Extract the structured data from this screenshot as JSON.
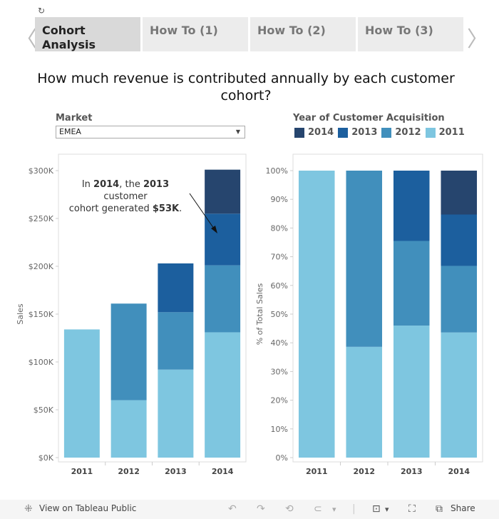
{
  "tabs": {
    "items": [
      {
        "label": "Cohort Analysis",
        "active": true
      },
      {
        "label": "How To (1)",
        "active": false
      },
      {
        "label": "How To (2)",
        "active": false
      },
      {
        "label": "How To (3)",
        "active": false
      }
    ]
  },
  "icons": {
    "refresh": "↻",
    "prev": "〈",
    "next": "〉"
  },
  "title": "How much revenue is contributed annually by each customer cohort?",
  "filter": {
    "label": "Market",
    "value": "EMEA",
    "arrow": "▼"
  },
  "legend": {
    "title": "Year of Customer Acquisition",
    "items": [
      {
        "label": "2014",
        "color": "#26456e"
      },
      {
        "label": "2013",
        "color": "#1c5f9e"
      },
      {
        "label": "2012",
        "color": "#418fbc"
      },
      {
        "label": "2011",
        "color": "#7ec6e0"
      }
    ]
  },
  "annotation": {
    "line1_pre": "In ",
    "line1_b1": "2014",
    "line1_mid": ", the ",
    "line1_b2": "2013",
    "line2": "customer",
    "line3_pre": "cohort generated ",
    "line3_b": "$53K",
    "line3_post": "."
  },
  "chart_data": [
    {
      "type": "bar",
      "stacked": true,
      "title": "",
      "xlabel": "",
      "ylabel": "Sales",
      "categories": [
        "2011",
        "2012",
        "2013",
        "2014"
      ],
      "ylim": [
        0,
        300
      ],
      "yticks": [
        "$0K",
        "$50K",
        "$100K",
        "$150K",
        "$200K",
        "$250K",
        "$300K"
      ],
      "units": "thousands USD",
      "series": [
        {
          "name": "2011",
          "color": "#7ec6e0",
          "values": [
            134,
            60,
            92,
            131
          ]
        },
        {
          "name": "2012",
          "color": "#418fbc",
          "values": [
            0,
            101,
            60,
            70
          ]
        },
        {
          "name": "2013",
          "color": "#1c5f9e",
          "values": [
            0,
            0,
            51,
            54
          ]
        },
        {
          "name": "2014",
          "color": "#26456e",
          "values": [
            0,
            0,
            0,
            46
          ]
        }
      ]
    },
    {
      "type": "bar",
      "stacked": true,
      "title": "",
      "xlabel": "",
      "ylabel": "% of Total Sales",
      "categories": [
        "2011",
        "2012",
        "2013",
        "2014"
      ],
      "ylim": [
        0,
        100
      ],
      "yticks": [
        "0%",
        "10%",
        "20%",
        "30%",
        "40%",
        "50%",
        "60%",
        "70%",
        "80%",
        "90%",
        "100%"
      ],
      "series": [
        {
          "name": "2011",
          "color": "#7ec6e0",
          "values": [
            100,
            38.6,
            46.0,
            43.6
          ]
        },
        {
          "name": "2012",
          "color": "#418fbc",
          "values": [
            0,
            61.4,
            29.5,
            23.2
          ]
        },
        {
          "name": "2013",
          "color": "#1c5f9e",
          "values": [
            0,
            0,
            24.5,
            17.9
          ]
        },
        {
          "name": "2014",
          "color": "#26456e",
          "values": [
            0,
            0,
            0,
            15.3
          ]
        }
      ]
    }
  ],
  "footer": {
    "view_label": "View on Tableau Public",
    "share_label": "Share",
    "icons": {
      "undo": "↶",
      "redo": "↷",
      "revert": "⟲",
      "pause": "⊂",
      "dropdown": "▾",
      "download": "⊡",
      "fullscreen": "⛶",
      "share": "⧉"
    }
  }
}
